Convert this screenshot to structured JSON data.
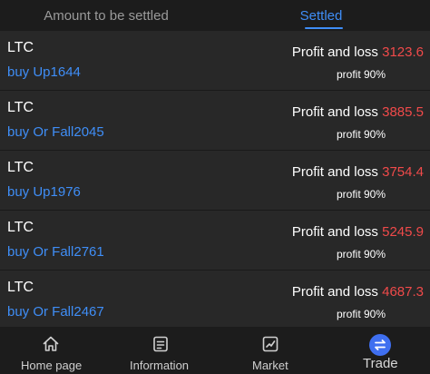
{
  "tabs": {
    "amount_to_be_settled": "Amount to be settled",
    "settled": "Settled"
  },
  "orders": [
    {
      "coin": "LTC",
      "direction": "buy Up1644",
      "pl_label": "Profit and loss",
      "pl_value": "3123.6",
      "profit": "profit 90%"
    },
    {
      "coin": "LTC",
      "direction": "buy Or Fall2045",
      "pl_label": "Profit and loss",
      "pl_value": "3885.5",
      "profit": "profit 90%"
    },
    {
      "coin": "LTC",
      "direction": "buy Up1976",
      "pl_label": "Profit and loss",
      "pl_value": "3754.4",
      "profit": "profit 90%"
    },
    {
      "coin": "LTC",
      "direction": "buy Or Fall2761",
      "pl_label": "Profit and loss",
      "pl_value": "5245.9",
      "profit": "profit 90%"
    },
    {
      "coin": "LTC",
      "direction": "buy Or Fall2467",
      "pl_label": "Profit and loss",
      "pl_value": "4687.3",
      "profit": "profit 90%"
    }
  ],
  "nav": {
    "home": "Home page",
    "information": "Information",
    "market": "Market",
    "trade": "Trade"
  },
  "colors": {
    "accent": "#3f8ef7",
    "loss_value": "#f04a4a",
    "row_bg": "#282828",
    "page_bg": "#1a1a1a"
  },
  "icons": {
    "home": "home-icon",
    "information": "document-icon",
    "market": "chart-icon",
    "trade": "swap-icon"
  }
}
